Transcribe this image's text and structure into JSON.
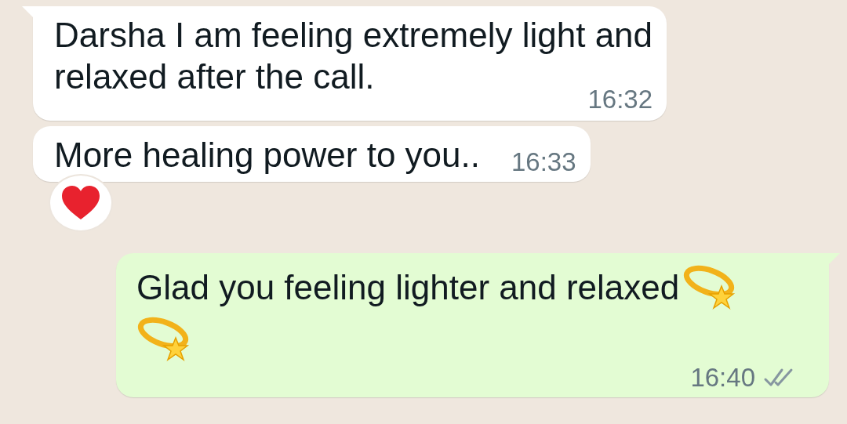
{
  "messages": [
    {
      "kind": "incoming",
      "tail": true,
      "lines": [
        "Darsha I am feeling extremely light and",
        "relaxed after the call."
      ],
      "time": "16:32"
    },
    {
      "kind": "incoming",
      "tail": false,
      "lines": [
        "More healing power to you.."
      ],
      "time": "16:33",
      "reaction": {
        "kind": "heart"
      }
    },
    {
      "kind": "outgoing",
      "tail": true,
      "lines": [
        "Glad you feeling lighter and relaxed"
      ],
      "stickers": [
        {
          "kind": "dizzy"
        },
        {
          "kind": "dizzy"
        }
      ],
      "time": "16:40",
      "read": false
    }
  ]
}
